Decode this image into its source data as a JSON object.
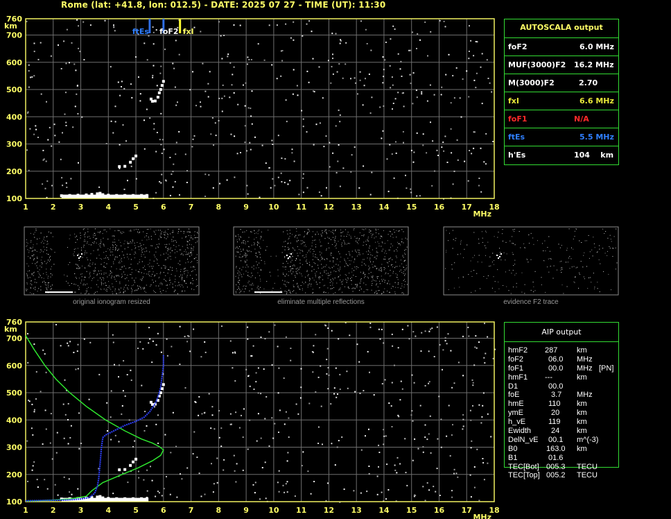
{
  "header": {
    "title": "Rome (lat: +41.8, lon: 012.5) - DATE: 2025 07 27 - TIME (UT): 11:30"
  },
  "colors": {
    "frame": "#f0f060",
    "axis_text": "#ffff66",
    "grid": "#6e6e6e",
    "box_border": "#33dd33",
    "foF2_marker": "#2f6fe6",
    "ftEs_marker": "#2f6fe6",
    "fxI_marker": "#ffff33",
    "profile_green": "#2ee62e",
    "profile_blue": "#2b3df0"
  },
  "autoscala": {
    "title": "AUTOSCALA output",
    "rows": [
      {
        "label": "foF2",
        "value": "6.0 MHz",
        "color": "#ffffff"
      },
      {
        "label": "MUF(3000)F2",
        "value": "16.2 MHz",
        "color": "#ffffff"
      },
      {
        "label": "M(3000)F2",
        "value": "2.70",
        "color": "#ffffff"
      },
      {
        "label": "fxI",
        "value": "6.6 MHz",
        "color": "#e8e83a"
      },
      {
        "label": "foF1",
        "value": "N/A",
        "color": "#ff2a2a"
      },
      {
        "label": "ftEs",
        "value": "5.5 MHz",
        "color": "#2f7fff"
      },
      {
        "label": "h'Es",
        "value": "104    km",
        "color": "#ffffff"
      }
    ]
  },
  "aip": {
    "title": "AIP output",
    "rows": [
      {
        "name": "hmF2",
        "value": "287",
        "unit": "km",
        "extra": ""
      },
      {
        "name": "foF2",
        "value": "06.0",
        "unit": "MHz",
        "extra": ""
      },
      {
        "name": "foF1",
        "value": "00.0",
        "unit": "MHz",
        "extra": "[PN]"
      },
      {
        "name": "hmF1",
        "value": "---",
        "unit": "km",
        "extra": ""
      },
      {
        "name": "D1",
        "value": "00.0",
        "unit": "",
        "extra": ""
      },
      {
        "name": "foE",
        "value": "3.7",
        "unit": "MHz",
        "extra": ""
      },
      {
        "name": "hmE",
        "value": "110",
        "unit": "km",
        "extra": ""
      },
      {
        "name": "ymE",
        "value": "20",
        "unit": "km",
        "extra": ""
      },
      {
        "name": "h_vE",
        "value": "119",
        "unit": "km",
        "extra": ""
      },
      {
        "name": "Ewidth",
        "value": "24",
        "unit": "km",
        "extra": ""
      },
      {
        "name": "DelN_vE",
        "value": "00.1",
        "unit": "m^(-3)",
        "extra": ""
      },
      {
        "name": "B0",
        "value": "163.0",
        "unit": "km",
        "extra": ""
      },
      {
        "name": "B1",
        "value": "01.6",
        "unit": "",
        "extra": ""
      },
      {
        "name": "TEC[Bot]",
        "value": "005.3",
        "unit": "TECU",
        "extra": ""
      },
      {
        "name": "TEC[Top]",
        "value": "005.2",
        "unit": "TECU",
        "extra": ""
      }
    ]
  },
  "thumbnails": {
    "captions": [
      "original ionogram resized",
      "eliminate multiple reflections",
      "evidence F2 trace"
    ]
  },
  "chart_data": [
    {
      "type": "scatter",
      "title": "",
      "xlabel": "MHz",
      "ylabel": "km",
      "xlim": [
        1,
        18
      ],
      "ylim": [
        100,
        760
      ],
      "x_ticks": [
        1,
        2,
        3,
        4,
        5,
        6,
        7,
        8,
        9,
        10,
        11,
        12,
        13,
        14,
        15,
        16,
        17,
        18
      ],
      "y_ticks": [
        100,
        200,
        300,
        400,
        500,
        600,
        700,
        760
      ],
      "grid": true,
      "markers": [
        {
          "label": "ftEs",
          "x": 5.5,
          "color": "#2f6fe6"
        },
        {
          "label": "foF2",
          "x": 6.0,
          "color": "#2f6fe6"
        },
        {
          "label": "fxI",
          "x": 6.6,
          "color": "#ffff33"
        }
      ],
      "series": [
        {
          "values": [
            [
              2.3,
              110
            ],
            [
              2.6,
              111
            ],
            [
              2.9,
              112
            ],
            [
              3.2,
              113
            ],
            [
              3.4,
              115
            ],
            [
              3.6,
              117
            ],
            [
              3.7,
              119
            ],
            [
              3.8,
              114
            ],
            [
              4.0,
              112
            ],
            [
              4.3,
              111
            ],
            [
              4.6,
              111
            ],
            [
              4.9,
              111
            ],
            [
              5.2,
              111
            ],
            [
              5.4,
              111
            ]
          ]
        },
        {
          "values": [
            [
              4.4,
              217
            ],
            [
              4.6,
              218
            ],
            [
              4.8,
              233
            ],
            [
              4.9,
              246
            ],
            [
              5.0,
              256
            ]
          ]
        },
        {
          "values": [
            [
              5.55,
              465
            ],
            [
              5.6,
              457
            ],
            [
              5.7,
              458
            ],
            [
              5.8,
              472
            ],
            [
              5.85,
              488
            ],
            [
              5.9,
              500
            ],
            [
              5.95,
              515
            ],
            [
              6.0,
              530
            ]
          ]
        }
      ]
    },
    {
      "type": "line",
      "title": "",
      "xlabel": "MHz",
      "ylabel": "km",
      "xlim": [
        1,
        18
      ],
      "ylim": [
        100,
        760
      ],
      "x_ticks": [
        1,
        2,
        3,
        4,
        5,
        6,
        7,
        8,
        9,
        10,
        11,
        12,
        13,
        14,
        15,
        16,
        17,
        18
      ],
      "y_ticks": [
        100,
        200,
        300,
        400,
        500,
        600,
        700,
        760
      ],
      "grid": true,
      "series": [
        {
          "values": [
            [
              1.0,
              710
            ],
            [
              1.3,
              660
            ],
            [
              1.7,
              600
            ],
            [
              2.1,
              550
            ],
            [
              2.6,
              500
            ],
            [
              3.2,
              450
            ],
            [
              3.9,
              400
            ],
            [
              4.6,
              360
            ],
            [
              5.2,
              330
            ],
            [
              5.6,
              315
            ],
            [
              5.85,
              302
            ],
            [
              6.0,
              290
            ],
            [
              5.9,
              270
            ],
            [
              5.6,
              250
            ],
            [
              5.1,
              225
            ],
            [
              4.5,
              200
            ],
            [
              3.8,
              170
            ],
            [
              3.4,
              140
            ],
            [
              3.2,
              120
            ],
            [
              2.6,
              110
            ],
            [
              2.0,
              106
            ],
            [
              1.5,
              103
            ],
            [
              1.0,
              102
            ]
          ]
        },
        {
          "values": [
            [
              1.0,
              103
            ],
            [
              1.5,
              104
            ],
            [
              2.0,
              105
            ],
            [
              2.5,
              106
            ],
            [
              3.0,
              110
            ],
            [
              3.3,
              115
            ],
            [
              3.5,
              130
            ],
            [
              3.6,
              155
            ],
            [
              3.65,
              185
            ],
            [
              3.7,
              240
            ],
            [
              3.75,
              300
            ],
            [
              3.8,
              335
            ],
            [
              3.9,
              345
            ],
            [
              4.2,
              360
            ],
            [
              4.6,
              380
            ],
            [
              5.0,
              395
            ],
            [
              5.3,
              410
            ],
            [
              5.5,
              430
            ],
            [
              5.7,
              460
            ],
            [
              5.8,
              485
            ],
            [
              5.9,
              520
            ],
            [
              5.95,
              560
            ],
            [
              6.0,
              600
            ],
            [
              6.0,
              640
            ]
          ]
        }
      ]
    }
  ]
}
